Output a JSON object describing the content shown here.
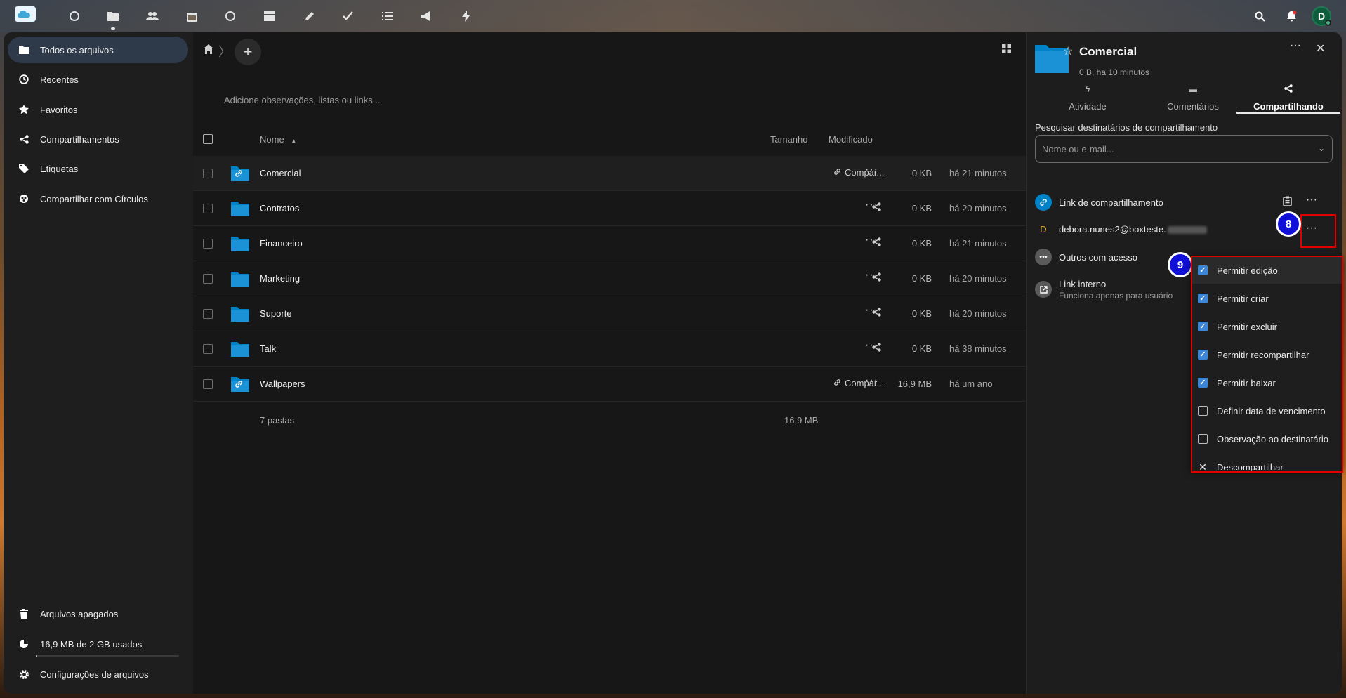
{
  "topbar": {
    "apps": [
      "dashboard-icon",
      "files-icon",
      "contacts-icon",
      "calendar-icon",
      "talk-icon",
      "deck-icon",
      "notes-icon",
      "tasks-icon",
      "list-icon",
      "announcements-icon",
      "activity-icon"
    ],
    "user_initial": "D"
  },
  "sidebar": {
    "items": [
      {
        "label": "Todos os arquivos",
        "icon": "folder-icon"
      },
      {
        "label": "Recentes",
        "icon": "clock-icon"
      },
      {
        "label": "Favoritos",
        "icon": "star-icon"
      },
      {
        "label": "Compartilhamentos",
        "icon": "share-icon"
      },
      {
        "label": "Etiquetas",
        "icon": "tag-icon"
      },
      {
        "label": "Compartilhar com Círculos",
        "icon": "circles-icon"
      }
    ],
    "bottom": {
      "trash": "Arquivos apagados",
      "quota": "16,9 MB de 2 GB usados",
      "quota_fraction": 0.0085,
      "settings": "Configurações de arquivos"
    }
  },
  "files": {
    "notes_placeholder": "Adicione observações, listas ou links...",
    "columns": {
      "name": "Nome",
      "size": "Tamanho",
      "modified": "Modificado"
    },
    "rows": [
      {
        "name": "Comercial",
        "share_label": "Compar...",
        "linked": true,
        "size": "0 KB",
        "modified": "há 21 minutos"
      },
      {
        "name": "Contratos",
        "share_label": "",
        "linked": false,
        "size": "0 KB",
        "modified": "há 20 minutos"
      },
      {
        "name": "Financeiro",
        "share_label": "",
        "linked": false,
        "size": "0 KB",
        "modified": "há 21 minutos"
      },
      {
        "name": "Marketing",
        "share_label": "",
        "linked": false,
        "size": "0 KB",
        "modified": "há 20 minutos"
      },
      {
        "name": "Suporte",
        "share_label": "",
        "linked": false,
        "size": "0 KB",
        "modified": "há 20 minutos"
      },
      {
        "name": "Talk",
        "share_label": "",
        "linked": false,
        "size": "0 KB",
        "modified": "há 38 minutos"
      },
      {
        "name": "Wallpapers",
        "share_label": "Compar...",
        "linked": true,
        "size": "16,9 MB",
        "modified": "há um ano"
      }
    ],
    "summary": {
      "count": "7 pastas",
      "total": "16,9 MB"
    }
  },
  "details": {
    "title": "Comercial",
    "subtitle": "0 B, há 10 minutos",
    "tabs": [
      {
        "label": "Atividade",
        "icon": "activity-icon"
      },
      {
        "label": "Comentários",
        "icon": "comment-icon"
      },
      {
        "label": "Compartilhando",
        "icon": "share-icon"
      }
    ],
    "search_label": "Pesquisar destinatários de compartilhamento",
    "search_placeholder": "Nome ou e-mail...",
    "share_link": "Link de compartilhamento",
    "user_initial": "D",
    "user_email": "debora.nunes2@boxteste.",
    "others": "Outros com acesso",
    "internal_link": "Link interno",
    "internal_link_sub": "Funciona apenas para usuário"
  },
  "annotations": {
    "step_8": "8",
    "step_9": "9"
  },
  "menu": {
    "items": [
      {
        "label": "Permitir edição",
        "checked": true
      },
      {
        "label": "Permitir criar",
        "checked": true
      },
      {
        "label": "Permitir excluir",
        "checked": true
      },
      {
        "label": "Permitir recompartilhar",
        "checked": true
      },
      {
        "label": "Permitir baixar",
        "checked": true
      },
      {
        "label": "Definir data de vencimento",
        "checked": false
      },
      {
        "label": "Observação ao destinatário",
        "checked": false
      }
    ],
    "unshare": "Descompartilhar"
  },
  "colors": {
    "accent": "#0082c9",
    "badge": "#1010d8",
    "highlight": "#e00000"
  }
}
